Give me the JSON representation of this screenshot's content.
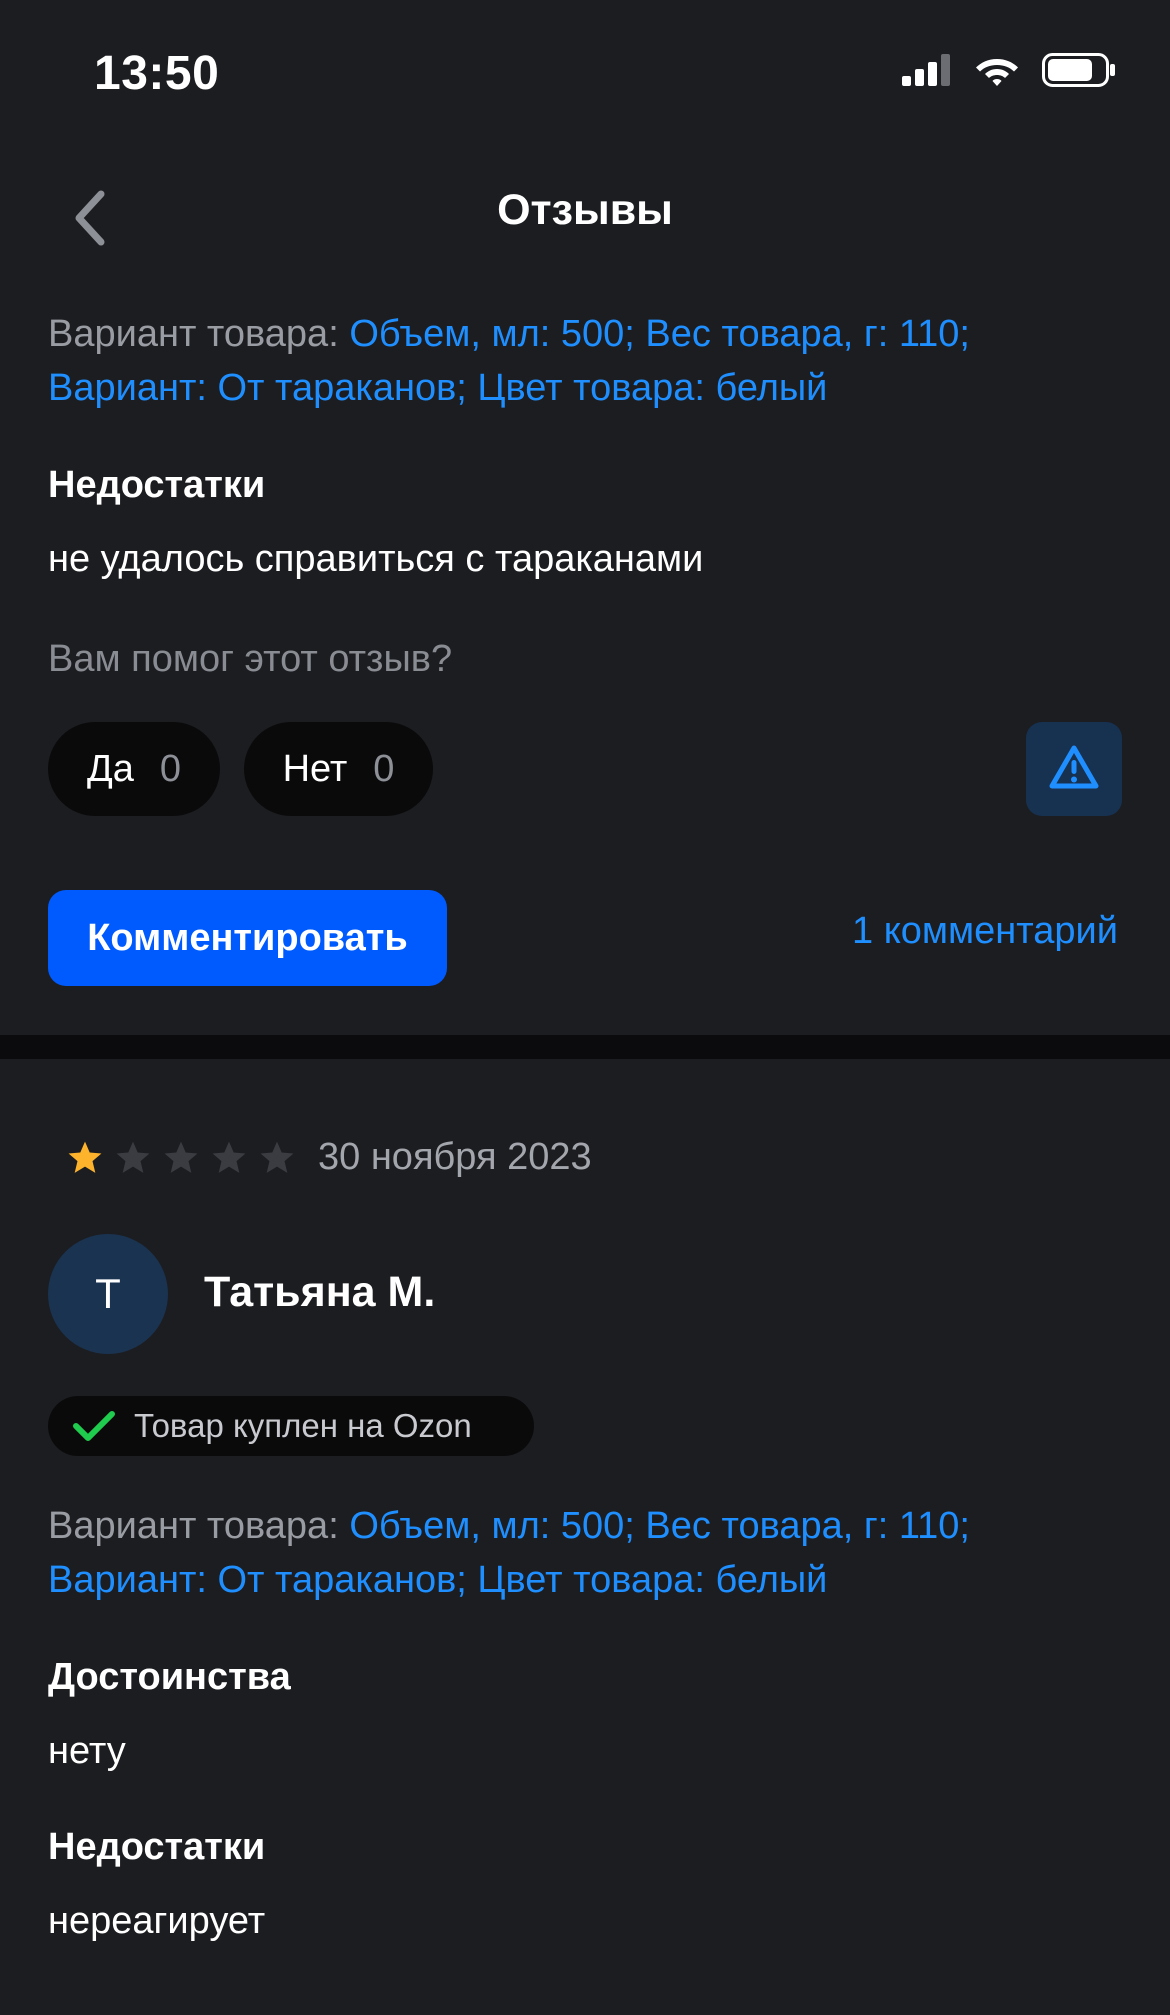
{
  "status_bar": {
    "time": "13:50",
    "icons": [
      "cellular-signal-icon",
      "wifi-icon",
      "battery-icon"
    ]
  },
  "nav": {
    "back_icon": "chevron-left-icon",
    "title": "Отзывы"
  },
  "review_1": {
    "variant_label": "Вариант товара: ",
    "variant_value_line1": "Объем, мл: 500; Вес товара, г: 110;",
    "variant_value_line2": "Вариант: От тараканов; Цвет товара: белый",
    "cons_title": "Недостатки",
    "cons_text": "не удалось справиться с тараканами",
    "helpful_question": "Вам помог этот отзыв?",
    "yes_label": "Да",
    "yes_count": "0",
    "no_label": "Нет",
    "no_count": "0",
    "report_icon": "warning-triangle-icon",
    "comment_button": "Комментировать",
    "comments_link": "1 комментарий"
  },
  "review_2": {
    "rating": 1,
    "rating_max": 5,
    "date": "30 ноября 2023",
    "avatar_initial": "Т",
    "author": "Татьяна М.",
    "badge_text": "Товар куплен на Ozon",
    "badge_icon": "checkmark-icon",
    "variant_label": "Вариант товара: ",
    "variant_value_line1": "Объем, мл: 500; Вес товара, г: 110;",
    "variant_value_line2": "Вариант: От тараканов; Цвет товара: белый",
    "pros_title": "Достоинства",
    "pros_text": "нету",
    "cons_title": "Недостатки",
    "cons_text": "нереагирует"
  },
  "colors": {
    "background": "#1c1d21",
    "accent": "#005bff",
    "link": "#1f8fff",
    "star_active": "#fdb42c",
    "star_inactive": "#3a3c42",
    "check": "#1fcc4e"
  }
}
